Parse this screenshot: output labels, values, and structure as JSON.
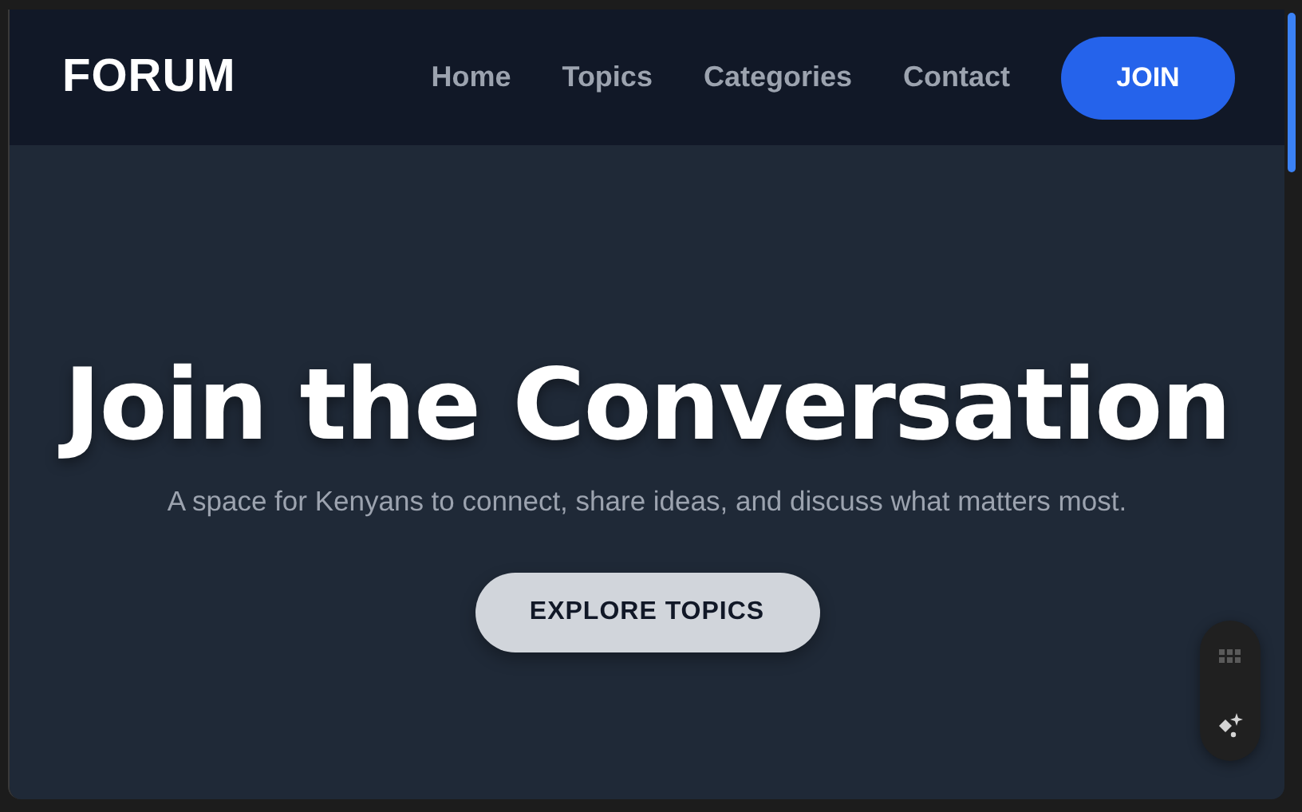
{
  "nav": {
    "logo": "FORUM",
    "links": [
      {
        "label": "Home"
      },
      {
        "label": "Topics"
      },
      {
        "label": "Categories"
      },
      {
        "label": "Contact"
      }
    ],
    "cta": "JOIN"
  },
  "hero": {
    "title": "Join the Conversation",
    "subtitle": "A space for Kenyans to connect, share ideas, and discuss what matters most.",
    "button": "EXPLORE TOPICS"
  }
}
